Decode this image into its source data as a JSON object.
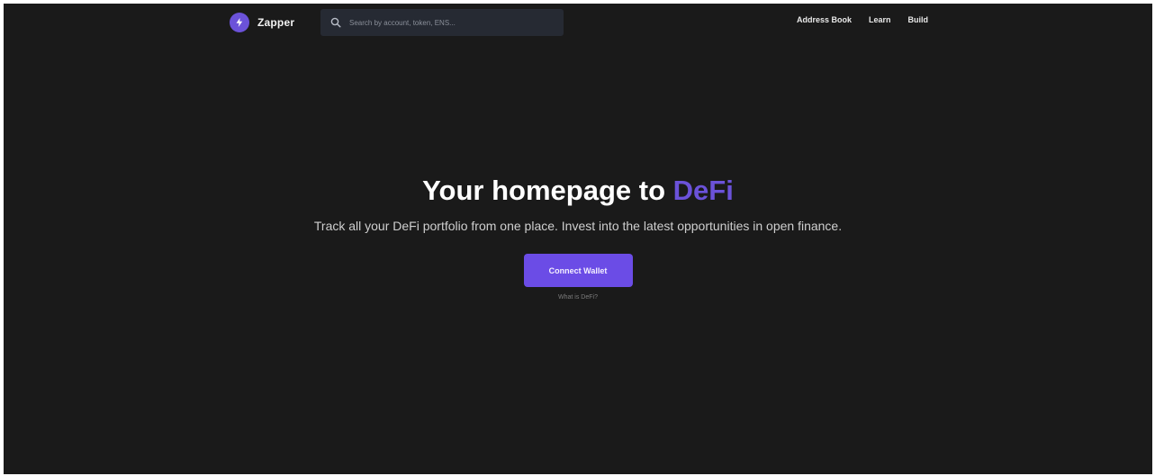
{
  "brand": {
    "name": "Zapper",
    "icon": "zapper-logo-icon",
    "color": "#6b52d9"
  },
  "search": {
    "icon": "search-icon",
    "placeholder": "Search by account, token, ENS..."
  },
  "nav": {
    "items": [
      {
        "label": "Address Book"
      },
      {
        "label": "Learn"
      },
      {
        "label": "Build"
      }
    ]
  },
  "hero": {
    "title_prefix": "Your homepage to",
    "title_accent": "DeFi",
    "subtitle": "Track all your DeFi portfolio from one place. Invest into the latest opportunities in open finance.",
    "cta_label": "Connect Wallet",
    "help_text": "What is DeFi?"
  },
  "colors": {
    "background": "#1a1a1a",
    "accent": "#6b52d9",
    "button": "#6b4ce6"
  }
}
